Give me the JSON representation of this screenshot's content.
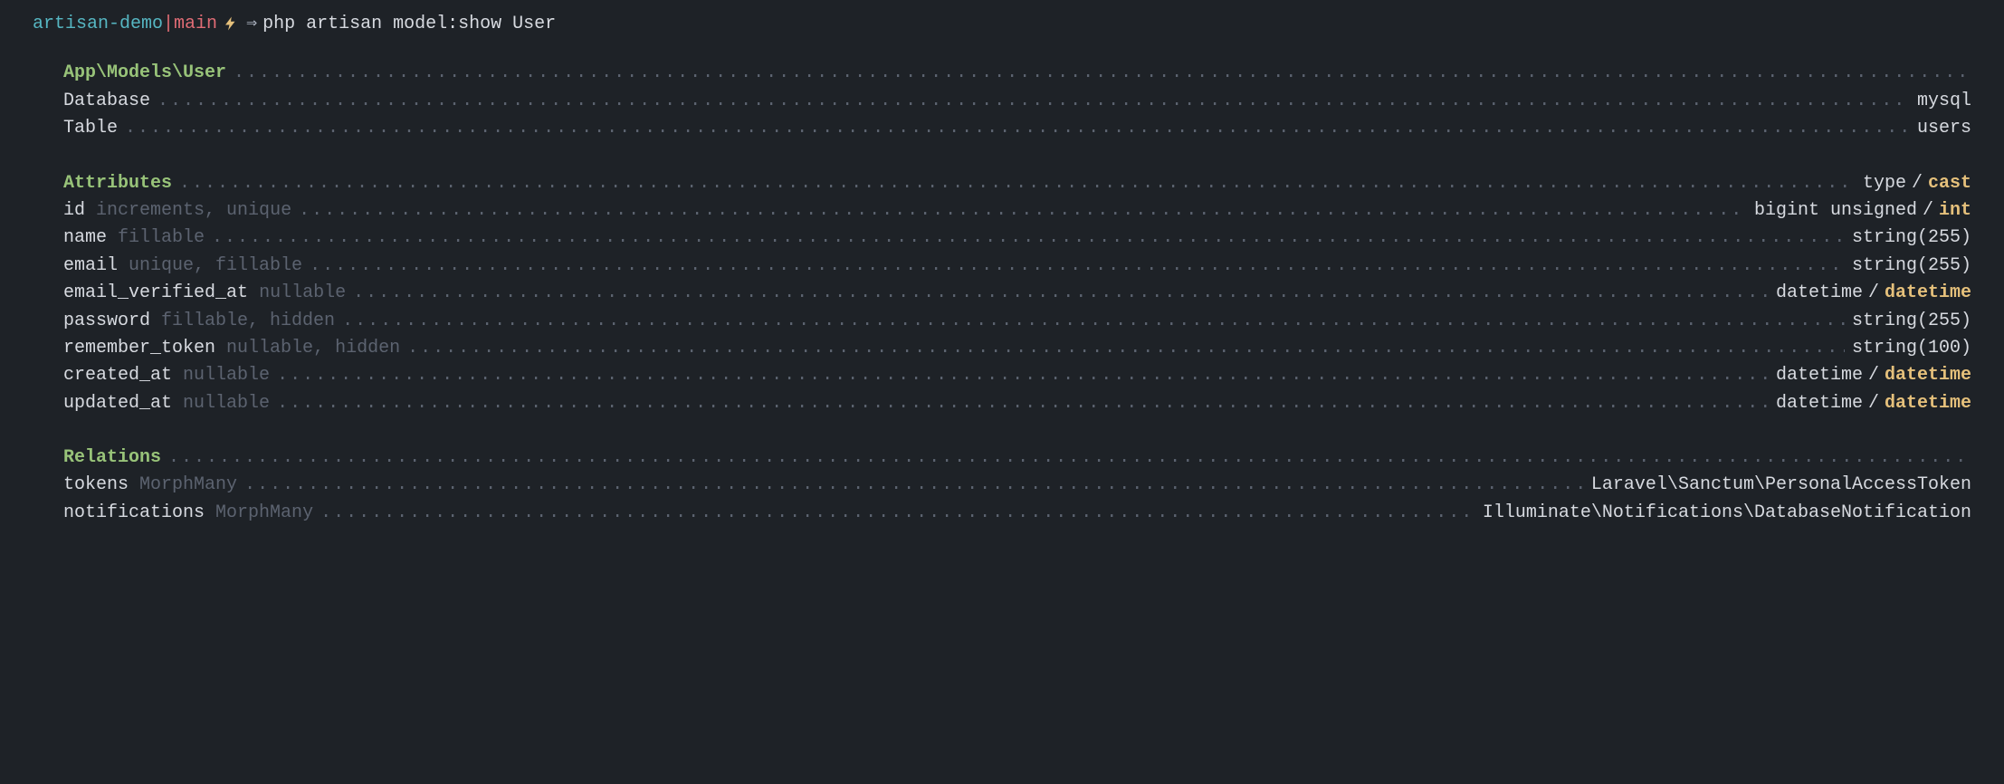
{
  "prompt": {
    "dir": "artisan-demo",
    "sep": "|",
    "branch": "main",
    "arrow": "⇒",
    "command": "php artisan model:show User"
  },
  "model": {
    "class": "App\\Models\\User",
    "database_label": "Database",
    "database_value": "mysql",
    "table_label": "Table",
    "table_value": "users"
  },
  "attributes": {
    "heading": "Attributes",
    "header_type": "type",
    "header_cast": "cast",
    "rows": [
      {
        "name": "id",
        "flags": "increments, unique",
        "type": "bigint unsigned",
        "cast": "int"
      },
      {
        "name": "name",
        "flags": "fillable",
        "type": "string(255)",
        "cast": ""
      },
      {
        "name": "email",
        "flags": "unique, fillable",
        "type": "string(255)",
        "cast": ""
      },
      {
        "name": "email_verified_at",
        "flags": "nullable",
        "type": "datetime",
        "cast": "datetime"
      },
      {
        "name": "password",
        "flags": "fillable, hidden",
        "type": "string(255)",
        "cast": ""
      },
      {
        "name": "remember_token",
        "flags": "nullable, hidden",
        "type": "string(100)",
        "cast": ""
      },
      {
        "name": "created_at",
        "flags": "nullable",
        "type": "datetime",
        "cast": "datetime"
      },
      {
        "name": "updated_at",
        "flags": "nullable",
        "type": "datetime",
        "cast": "datetime"
      }
    ]
  },
  "relations": {
    "heading": "Relations",
    "rows": [
      {
        "name": "tokens",
        "type": "MorphMany",
        "target": "Laravel\\Sanctum\\PersonalAccessToken"
      },
      {
        "name": "notifications",
        "type": "MorphMany",
        "target": "Illuminate\\Notifications\\DatabaseNotification"
      }
    ]
  }
}
